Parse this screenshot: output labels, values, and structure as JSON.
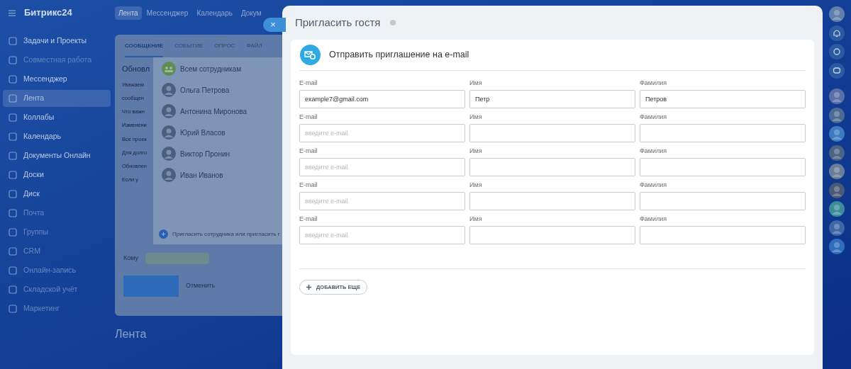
{
  "app": {
    "logo": "Битрикс24",
    "top_nav": [
      {
        "label": "Лента",
        "selected": true
      },
      {
        "label": "Мессенджер",
        "selected": false
      },
      {
        "label": "Календарь",
        "selected": false
      },
      {
        "label": "Докум",
        "selected": false
      }
    ]
  },
  "sidebar": {
    "items": [
      {
        "label": "Задачи и Проекты",
        "selected": false
      },
      {
        "label": "Совместная работа",
        "selected": false
      },
      {
        "label": "Мессенджер",
        "selected": false
      },
      {
        "label": "Лента",
        "selected": true
      },
      {
        "label": "Коллабы",
        "selected": false
      },
      {
        "label": "Календарь",
        "selected": false
      },
      {
        "label": "Документы Онлайн",
        "selected": false
      },
      {
        "label": "Доски",
        "selected": false
      },
      {
        "label": "Диск",
        "selected": false
      },
      {
        "label": "Почта",
        "selected": false
      },
      {
        "label": "Группы",
        "selected": false
      },
      {
        "label": "CRM",
        "selected": false
      },
      {
        "label": "Онлайн-запись",
        "selected": false
      },
      {
        "label": "Складской учёт",
        "selected": false
      },
      {
        "label": "Маркетинг",
        "selected": false
      }
    ]
  },
  "composer": {
    "tabs": [
      {
        "label": "СООБЩЕНИЕ",
        "selected": true
      },
      {
        "label": "СОБЫТИЕ",
        "selected": false
      },
      {
        "label": "ОПРОС",
        "selected": false
      },
      {
        "label": "ФАЙЛ",
        "selected": false
      }
    ],
    "title": "Обновл",
    "lines": [
      "Уважаем",
      "сообщен",
      "Что важн",
      "Изменени",
      "Все проек",
      "Для долго",
      "Обновлен",
      "Если у"
    ],
    "recipients": [
      {
        "name": "Всем сотрудникам",
        "kind": "group"
      },
      {
        "name": "Ольга Петрова",
        "kind": "person"
      },
      {
        "name": "Антонина Миронова",
        "kind": "person"
      },
      {
        "name": "Юрий Власов",
        "kind": "person"
      },
      {
        "name": "Виктор Пронин",
        "kind": "person"
      },
      {
        "name": "Иван Иванов",
        "kind": "person"
      }
    ],
    "invite_link": "Пригласить сотрудника или пригласить г",
    "to_label": "Кому",
    "cancel": "Отменить"
  },
  "feed_title": "Лента",
  "modal": {
    "close": "×",
    "title": "Пригласить гостя",
    "section_title": "Отправить приглашение на e-mail",
    "rows": [
      {
        "fields": [
          {
            "label": "E-mail",
            "value": "example7@gmail.com"
          },
          {
            "label": "Имя",
            "value": "Петр"
          },
          {
            "label": "Фамилия",
            "value": "Петров"
          }
        ]
      },
      {
        "fields": [
          {
            "label": "E-mail",
            "placeholder": "введите e-mail"
          },
          {
            "label": "Имя"
          },
          {
            "label": "Фамилия"
          }
        ]
      },
      {
        "fields": [
          {
            "label": "E-mail",
            "placeholder": "введите e-mail"
          },
          {
            "label": "Имя"
          },
          {
            "label": "Фамилия"
          }
        ]
      },
      {
        "fields": [
          {
            "label": "E-mail",
            "placeholder": "введите e-mail"
          },
          {
            "label": "Имя"
          },
          {
            "label": "Фамилия"
          }
        ]
      },
      {
        "fields": [
          {
            "label": "E-mail",
            "placeholder": "введите e-mail"
          },
          {
            "label": "Имя"
          },
          {
            "label": "Фамилия"
          }
        ]
      }
    ],
    "add_more": "ДОБАВИТЬ ЕЩЕ"
  }
}
